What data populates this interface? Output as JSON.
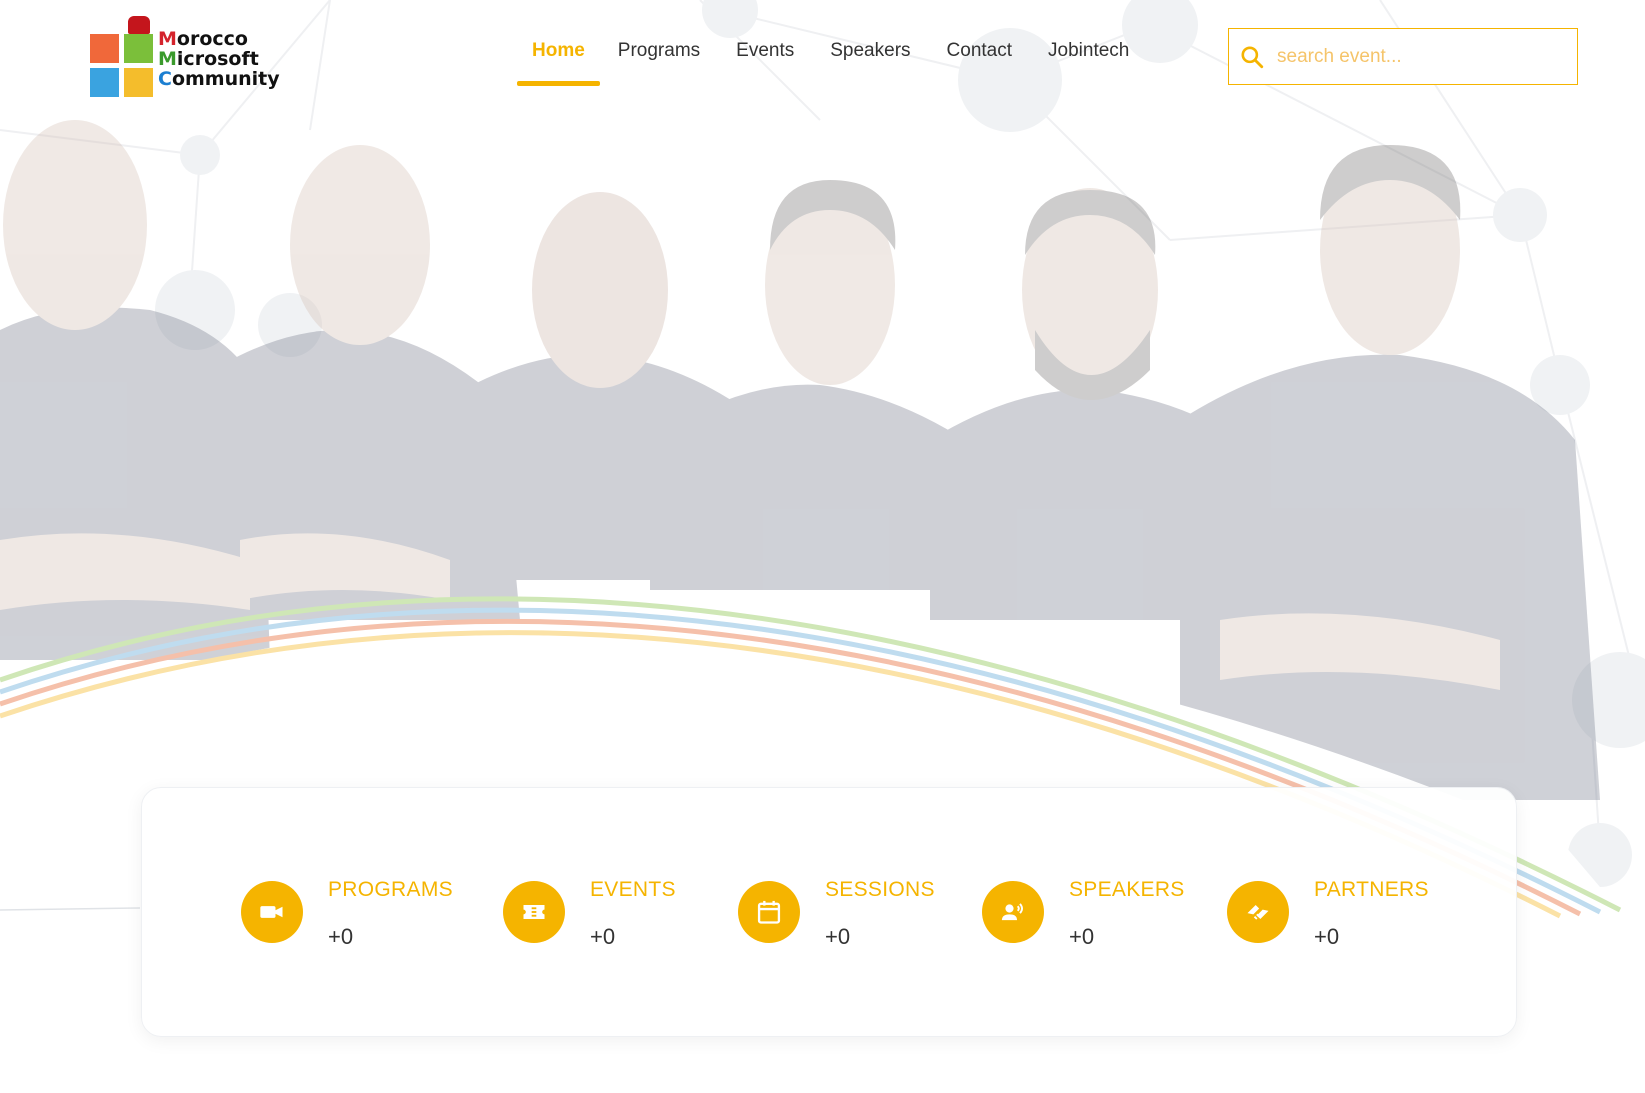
{
  "brand": {
    "logo_line1": "Morocco",
    "logo_line2": "Microsoft",
    "logo_line3": "Community"
  },
  "nav": {
    "items": [
      {
        "label": "Home",
        "active": true
      },
      {
        "label": "Programs",
        "active": false
      },
      {
        "label": "Events",
        "active": false
      },
      {
        "label": "Speakers",
        "active": false
      },
      {
        "label": "Contact",
        "active": false
      },
      {
        "label": "Jobintech",
        "active": false
      }
    ]
  },
  "search": {
    "placeholder": "search event...",
    "value": "",
    "icon": "search-icon"
  },
  "stats": [
    {
      "label": "PROGRAMS",
      "value": "+0",
      "icon": "video-camera-icon"
    },
    {
      "label": "EVENTS",
      "value": "+0",
      "icon": "ticket-icon"
    },
    {
      "label": "SESSIONS",
      "value": "+0",
      "icon": "calendar-icon"
    },
    {
      "label": "SPEAKERS",
      "value": "+0",
      "icon": "speaker-icon"
    },
    {
      "label": "PARTNERS",
      "value": "+0",
      "icon": "handshake-icon"
    }
  ],
  "colors": {
    "accent": "#f5b400",
    "text": "#333333",
    "shirt": "#3b4258",
    "rainbow": [
      "#7bbf3a",
      "#3aa3e0",
      "#f0683a",
      "#f4bd2c"
    ]
  }
}
